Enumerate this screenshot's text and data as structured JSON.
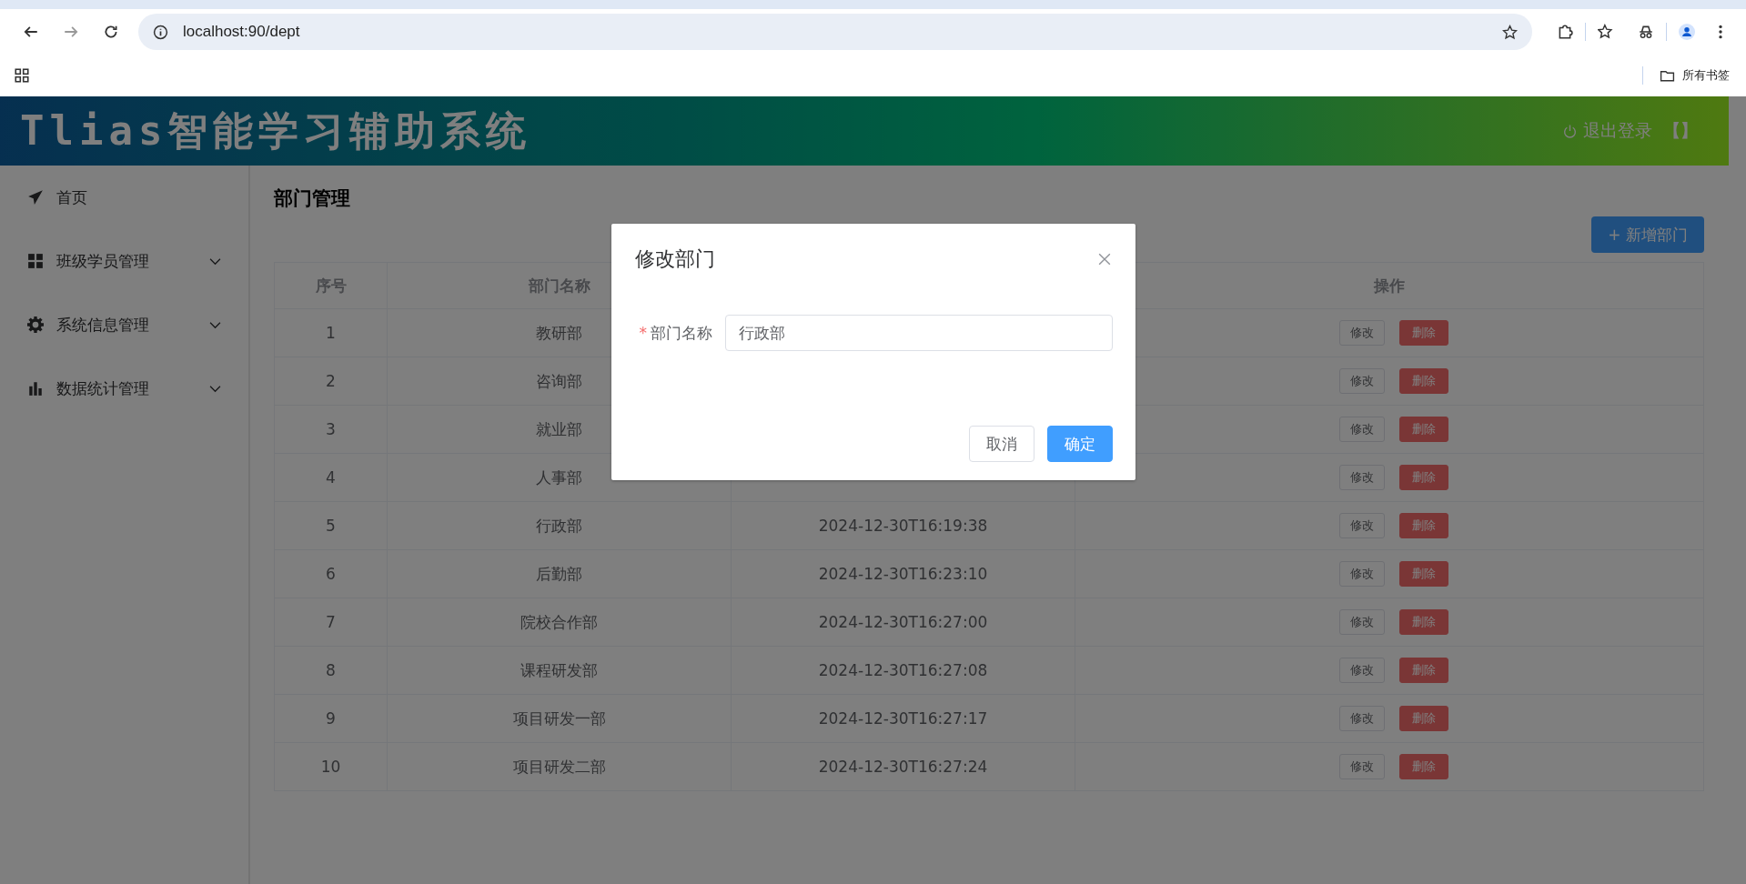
{
  "browser": {
    "url": "localhost:90/dept",
    "bookmarks_label": "所有书签"
  },
  "header": {
    "title": "Tlias智能学习辅助系统",
    "logout": "退出登录",
    "bracket": "【】"
  },
  "sidebar": {
    "items": [
      {
        "label": "首页",
        "kind": "link"
      },
      {
        "label": "班级学员管理",
        "kind": "submenu",
        "expanded": false
      },
      {
        "label": "系统信息管理",
        "kind": "submenu",
        "expanded": false
      },
      {
        "label": "数据统计管理",
        "kind": "submenu",
        "expanded": false
      }
    ]
  },
  "page_title": "部门管理",
  "add_button": "+ 新增部门",
  "table": {
    "columns": {
      "index": "序号",
      "name": "部门名称",
      "actions": "操作"
    },
    "rows": [
      {
        "index": "1",
        "name": "教研部",
        "edit": "修改",
        "delete": "删除"
      },
      {
        "index": "2",
        "name": "咨询部",
        "edit": "修改",
        "delete": "删除"
      },
      {
        "index": "3",
        "name": "就业部",
        "edit": "修改",
        "delete": "删除"
      },
      {
        "index": "4",
        "name": "人事部",
        "edit": "修改",
        "delete": "删除"
      },
      {
        "index": "5",
        "name": "行政部",
        "time": "2024-12-30T16:19:38",
        "edit": "修改",
        "delete": "删除"
      },
      {
        "index": "6",
        "name": "后勤部",
        "time": "2024-12-30T16:23:10",
        "edit": "修改",
        "delete": "删除"
      },
      {
        "index": "7",
        "name": "院校合作部",
        "time": "2024-12-30T16:27:00",
        "edit": "修改",
        "delete": "删除"
      },
      {
        "index": "8",
        "name": "课程研发部",
        "time": "2024-12-30T16:27:08",
        "edit": "修改",
        "delete": "删除"
      },
      {
        "index": "9",
        "name": "项目研发一部",
        "time": "2024-12-30T16:27:17",
        "edit": "修改",
        "delete": "删除"
      },
      {
        "index": "10",
        "name": "项目研发二部",
        "time": "2024-12-30T16:27:24",
        "edit": "修改",
        "delete": "删除"
      }
    ]
  },
  "dialog": {
    "title": "修改部门",
    "field_label": "部门名称",
    "required_mark": "*",
    "value": "行政部",
    "cancel": "取消",
    "confirm": "确定"
  }
}
